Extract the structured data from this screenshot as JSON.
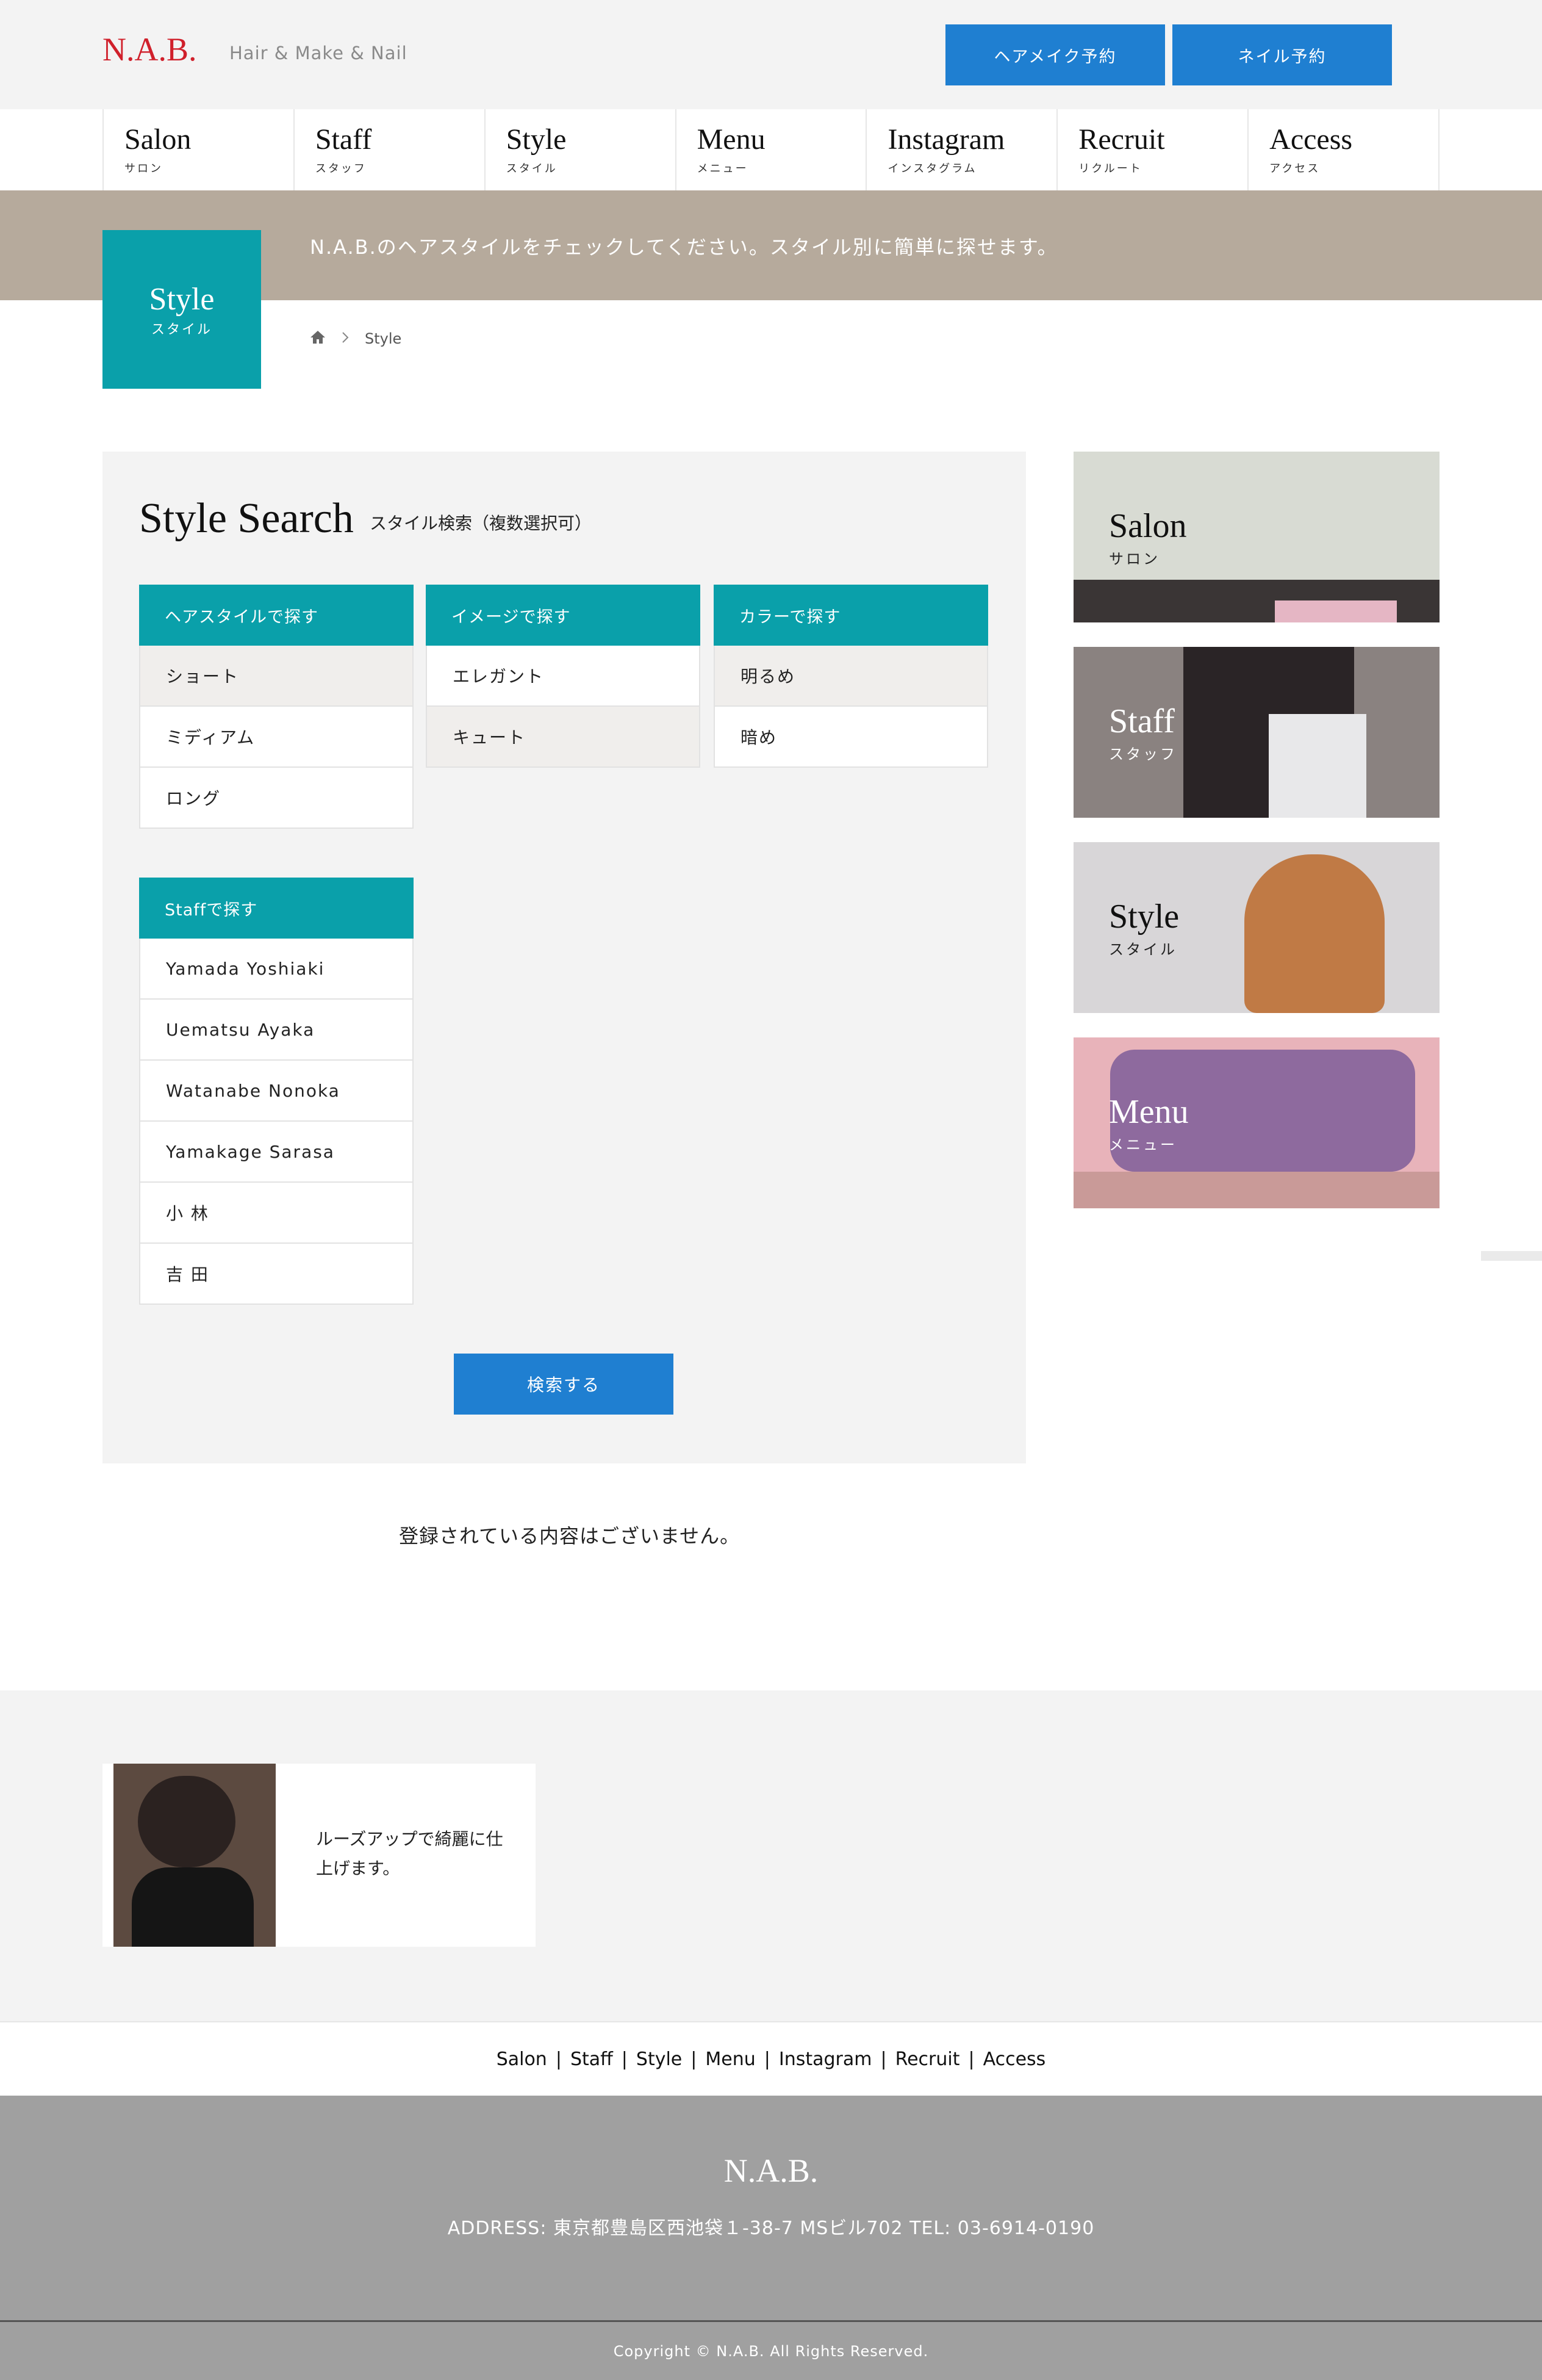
{
  "header": {
    "logo": "N.A.B.",
    "tagline": "Hair & Make & Nail",
    "buttons": [
      "ヘアメイク予約",
      "ネイル予約"
    ]
  },
  "nav": [
    {
      "en": "Salon",
      "jp": "サロン"
    },
    {
      "en": "Staff",
      "jp": "スタッフ"
    },
    {
      "en": "Style",
      "jp": "スタイル"
    },
    {
      "en": "Menu",
      "jp": "メニュー"
    },
    {
      "en": "Instagram",
      "jp": "インスタグラム"
    },
    {
      "en": "Recruit",
      "jp": "リクルート"
    },
    {
      "en": "Access",
      "jp": "アクセス"
    }
  ],
  "banner": {
    "text": "N.A.B.のヘアスタイルをチェックしてください。スタイル別に簡単に探せます。",
    "title_en": "Style",
    "title_jp": "スタイル"
  },
  "breadcrumb": {
    "current": "Style"
  },
  "search": {
    "title": "Style Search",
    "subtitle": "スタイル検索（複数選択可）",
    "groups": [
      {
        "head": "ヘアスタイルで探す",
        "options": [
          {
            "label": "ショート",
            "selected": true
          },
          {
            "label": "ミディアム",
            "selected": false
          },
          {
            "label": "ロング",
            "selected": false
          }
        ]
      },
      {
        "head": "イメージで探す",
        "options": [
          {
            "label": "エレガント",
            "selected": false
          },
          {
            "label": "キュート",
            "selected": true
          }
        ]
      },
      {
        "head": "カラーで探す",
        "options": [
          {
            "label": "明るめ",
            "selected": true
          },
          {
            "label": "暗め",
            "selected": false
          }
        ]
      },
      {
        "head": "Staffで探す",
        "options": [
          {
            "label": "Yamada Yoshiaki",
            "selected": false
          },
          {
            "label": "Uematsu Ayaka",
            "selected": false
          },
          {
            "label": "Watanabe Nonoka",
            "selected": false
          },
          {
            "label": "Yamakage Sarasa",
            "selected": false
          },
          {
            "label": "小 林",
            "selected": false
          },
          {
            "label": "吉 田",
            "selected": false
          }
        ]
      }
    ],
    "submit": "検索する"
  },
  "empty_message": "登録されている内容はございません。",
  "sidebar": [
    {
      "en": "Salon",
      "jp": "サロン",
      "color": "#c9ccc4"
    },
    {
      "en": "Staff",
      "jp": "スタッフ",
      "color": "#8a8280"
    },
    {
      "en": "Style",
      "jp": "スタイル",
      "color": "#d8d6d8"
    },
    {
      "en": "Menu",
      "jp": "メニュー",
      "color": "#d9a3aa"
    }
  ],
  "card": {
    "text": "ルーズアップで綺麗に仕上げます。"
  },
  "footer_nav": [
    "Salon",
    "Staff",
    "Style",
    "Menu",
    "Instagram",
    "Recruit",
    "Access"
  ],
  "footer": {
    "logo": "N.A.B.",
    "address": "ADDRESS: 東京都豊島区西池袋１-38-7 MSビル702 TEL: 03-6914-0190",
    "copyright": "Copyright © N.A.B. All Rights Reserved."
  },
  "colors": {
    "accent": "#0aa0aa",
    "button": "#1f7fd1",
    "logo": "#d0202b",
    "banner": "#b6aa9c"
  }
}
